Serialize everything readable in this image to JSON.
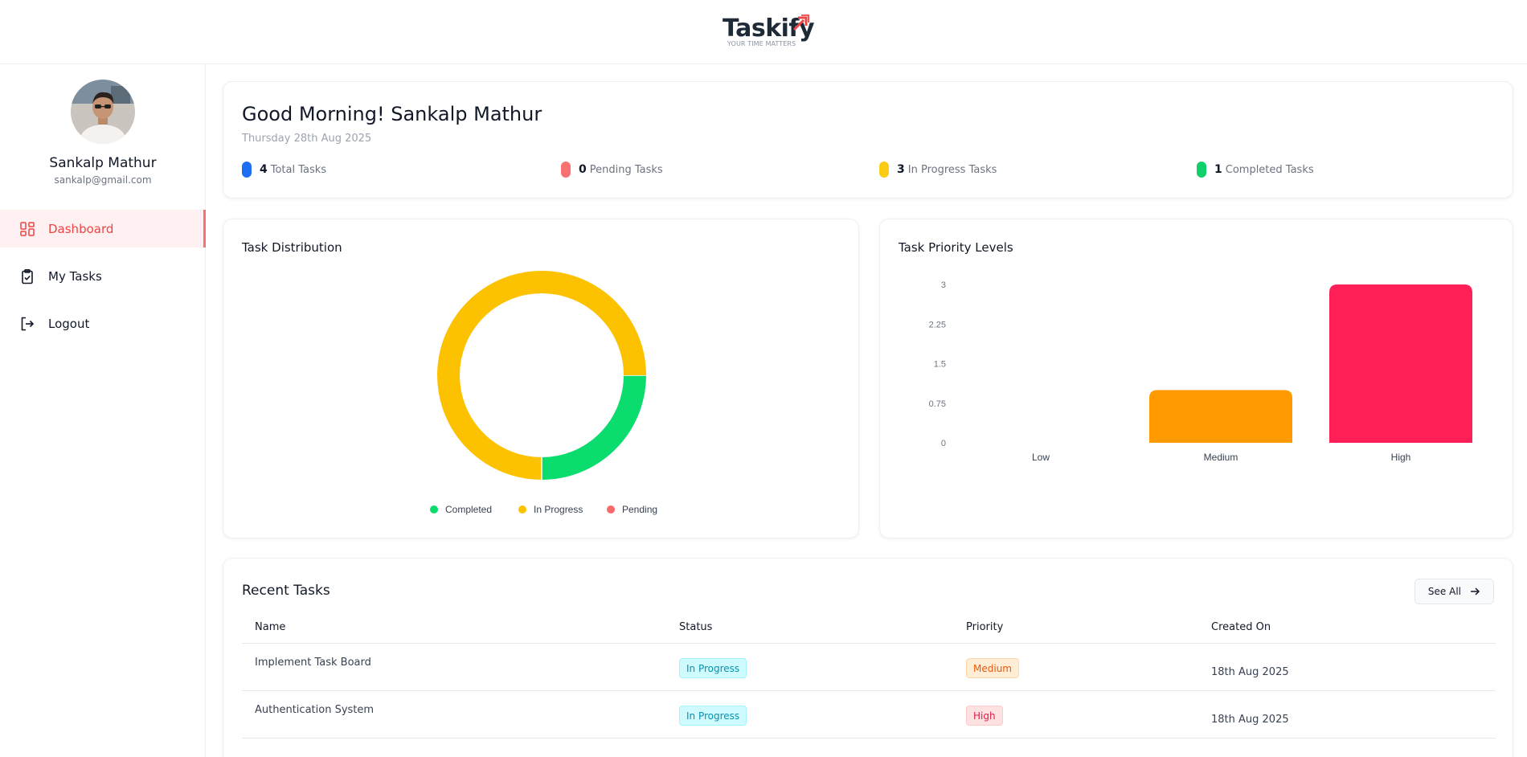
{
  "app": {
    "name": "Taskify",
    "tagline": "YOUR TIME MATTERS"
  },
  "profile": {
    "name": "Sankalp Mathur",
    "email": "sankalp@gmail.com"
  },
  "nav": {
    "items": [
      {
        "label": "Dashboard",
        "icon": "dashboard-grid-icon",
        "active": true
      },
      {
        "label": "My Tasks",
        "icon": "clipboard-check-icon",
        "active": false
      },
      {
        "label": "Logout",
        "icon": "logout-icon",
        "active": false
      }
    ]
  },
  "greeting": {
    "title": "Good Morning! Sankalp Mathur",
    "date": "Thursday 28th Aug 2025"
  },
  "stats": [
    {
      "count": "4",
      "label": "Total Tasks",
      "color": "#1e6ef4"
    },
    {
      "count": "0",
      "label": "Pending Tasks",
      "color": "#f87171"
    },
    {
      "count": "3",
      "label": "In Progress Tasks",
      "color": "#facc15"
    },
    {
      "count": "1",
      "label": "Completed Tasks",
      "color": "#10d06a"
    }
  ],
  "distribution": {
    "title": "Task Distribution"
  },
  "priority": {
    "title": "Task Priority Levels"
  },
  "chart_data": [
    {
      "type": "pie",
      "title": "Task Distribution",
      "donut": true,
      "labels": [
        "Completed",
        "In Progress",
        "Pending"
      ],
      "values": [
        1,
        3,
        0
      ],
      "colors": [
        "#0bdc6e",
        "#fcc200",
        "#fb6a6a"
      ],
      "legend": "bottom"
    },
    {
      "type": "bar",
      "title": "Task Priority Levels",
      "categories": [
        "Low",
        "Medium",
        "High"
      ],
      "values": [
        0,
        1,
        3
      ],
      "colors": [
        "#9ca3af",
        "#ff9b00",
        "#ff1f57"
      ],
      "ylim": [
        0,
        3
      ],
      "yticks": [
        "0",
        "0.75",
        "1.5",
        "2.25",
        "3"
      ],
      "grid": false
    }
  ],
  "recent": {
    "title": "Recent Tasks",
    "see_all_label": "See All",
    "columns": [
      "Name",
      "Status",
      "Priority",
      "Created On"
    ],
    "rows": [
      {
        "name": "Implement Task Board",
        "status": "In Progress",
        "priority": "Medium",
        "created": "18th Aug 2025"
      },
      {
        "name": "Authentication System",
        "status": "In Progress",
        "priority": "High",
        "created": "18th Aug 2025"
      }
    ]
  }
}
